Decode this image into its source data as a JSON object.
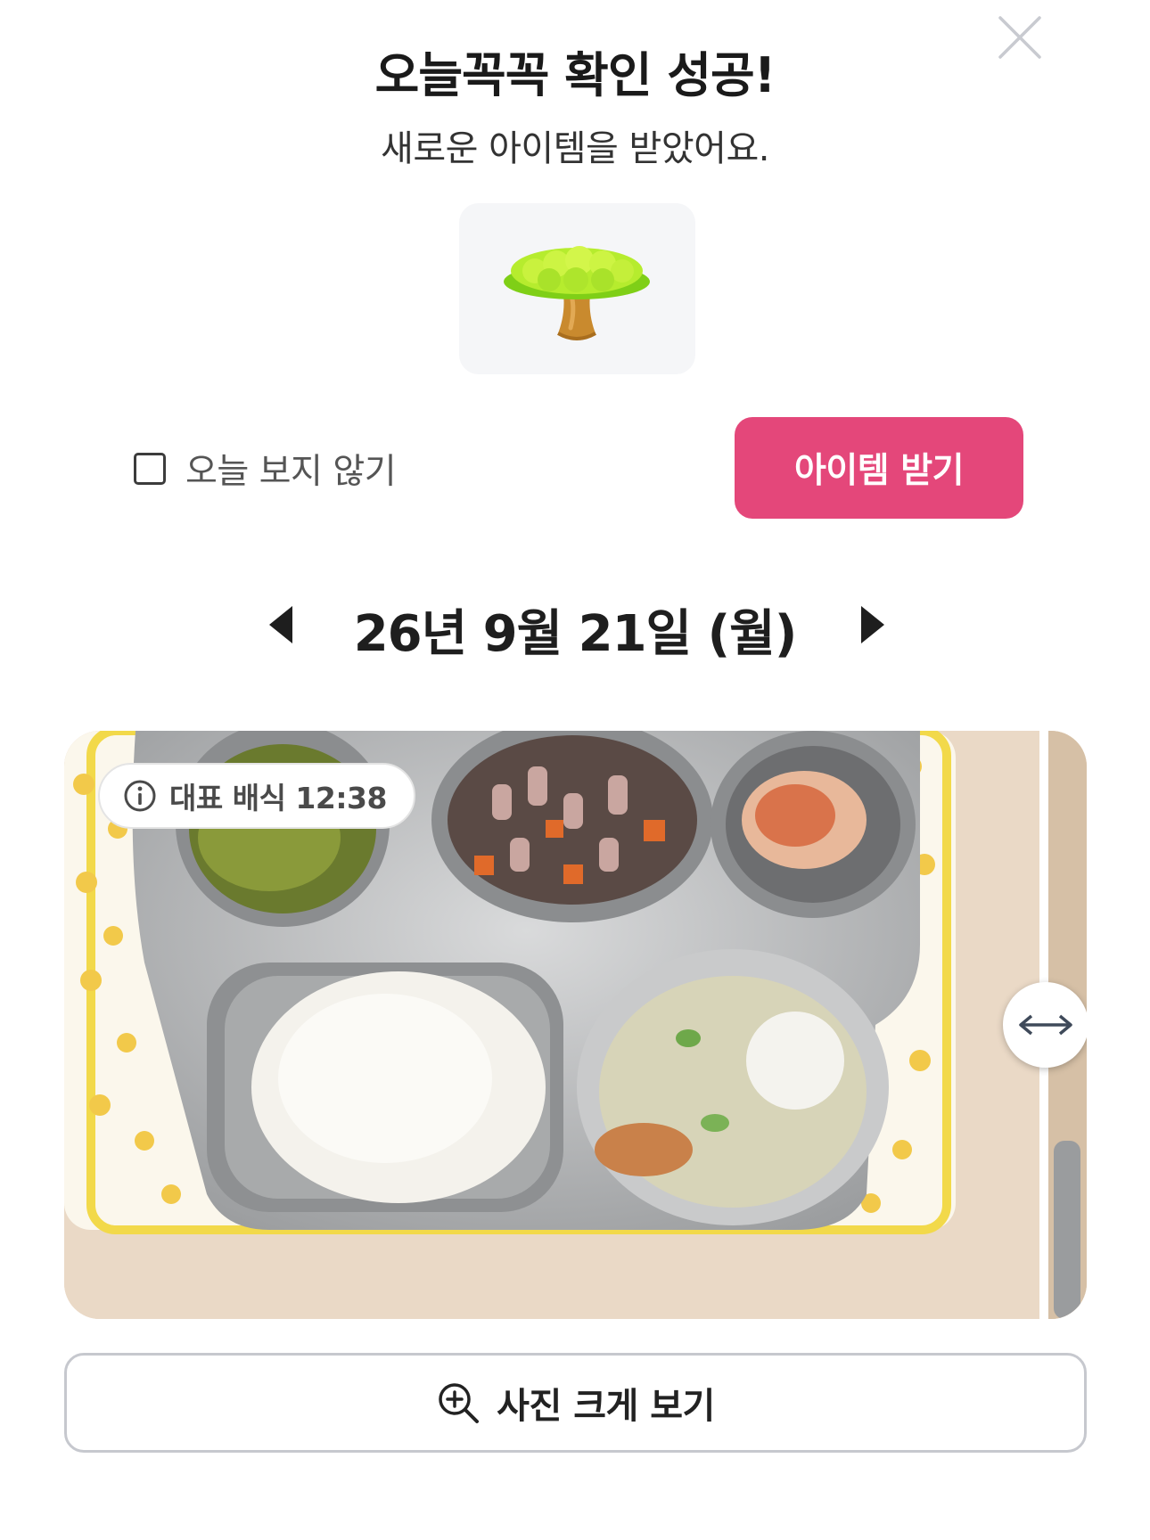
{
  "popup": {
    "title": "오늘꼭꼭 확인 성공!",
    "subtitle": "새로운 아이템을 받았어요.",
    "item_icon": "tree-icon",
    "dont_show_label": "오늘 보지 않기",
    "dont_show_checked": false,
    "get_item_button": "아이템 받기",
    "close_icon": "close-icon"
  },
  "date_nav": {
    "date": "26년 9월 21일 (월)",
    "prev_icon": "caret-left-icon",
    "next_icon": "caret-right-icon"
  },
  "photo": {
    "badge_label": "대표 배식 12:38",
    "badge_icon": "info-icon",
    "compare_handle_icon": "horizontal-arrows-icon"
  },
  "enlarge_button": {
    "label": "사진 크게 보기",
    "icon": "zoom-in-icon"
  },
  "colors": {
    "accent": "#e4477a",
    "item_bg": "#f5f6f8",
    "border": "#c6c8ce"
  }
}
